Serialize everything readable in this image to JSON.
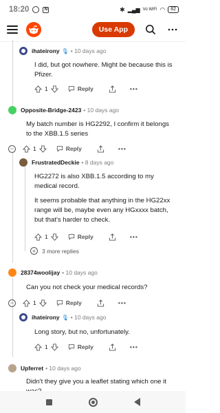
{
  "status_bar": {
    "time": "18:20",
    "left_icons": [
      "whatsapp-icon",
      "n-icon"
    ],
    "right_text": "Vo WiFi",
    "battery": "82"
  },
  "header": {
    "use_app_label": "Use App",
    "accent_color": "#d93a00",
    "logo_color": "#ff4500"
  },
  "comments": [
    {
      "author": "ihateirony",
      "time": "• 10 days ago",
      "body": [
        "I did, but got nowhere. Might be because this is Pfizer."
      ],
      "votes": "1",
      "reply_label": "Reply",
      "more_label": "•••",
      "has_mic": true,
      "avatar_color": "#4a4a8a"
    },
    {
      "author": "Opposite-Bridge-2423",
      "time": "• 10 days ago",
      "body": [
        "My batch number is HG2292, I confirm it belongs to the XBB.1.5 series"
      ],
      "votes": "1",
      "reply_label": "Reply",
      "more_label": "•••",
      "avatar_color": "#46d160"
    },
    {
      "author": "FrustratedDeckie",
      "time": "• 8 days ago",
      "body": [
        "HG2272 is also XBB.1.5 according to my medical record.",
        "It seems probable that anything in the HG22xx range will be, maybe even any HGxxxx batch, but that's harder to check."
      ],
      "votes": "1",
      "reply_label": "Reply",
      "more_label": "•••",
      "avatar_color": "#7a5c3e"
    },
    {
      "author": "28374woolijay",
      "time": "• 10 days ago",
      "body": [
        "Can you not check your medical records?"
      ],
      "votes": "1",
      "reply_label": "Reply",
      "more_label": "•••",
      "avatar_color": "#ff8717"
    },
    {
      "author": "ihateirony",
      "time": "• 10 days ago",
      "body": [
        "Long story, but no, unfortunately."
      ],
      "votes": "1",
      "reply_label": "Reply",
      "more_label": "•••",
      "has_mic": true,
      "avatar_color": "#4a4a8a"
    },
    {
      "author": "Upferret",
      "time": "• 10 days ago",
      "body": [
        "Didn't they give you a leaflet stating which one it was?"
      ],
      "avatar_color": "#b8a48a"
    }
  ],
  "more_replies_label": "3 more replies"
}
